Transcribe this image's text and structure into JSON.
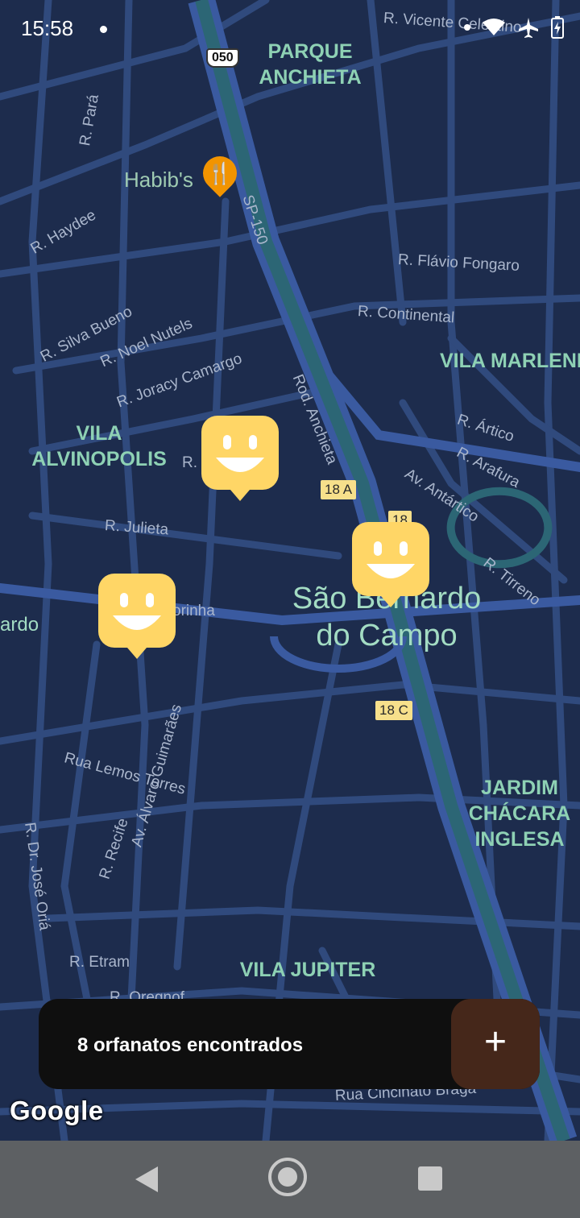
{
  "status_bar": {
    "time": "15:58"
  },
  "map": {
    "street_labels": [
      "R. Vicente Celestino",
      "R. Pará",
      "R. Haydee",
      "R. Flávio Fongaro",
      "R. Continental",
      "R. Silva Bueno",
      "R. Noel Nutels",
      "R. Joracy Camargo",
      "R. Ártico",
      "R. Arafura",
      "Av. Antártico",
      "R. Tirreno",
      "R. Julieta",
      "Rod. Anchieta",
      "SP-150",
      "Rua Lemos Torres",
      "R. Dr. José Oriá",
      "R. Recife",
      "Av. Álvaro Guimarães",
      "R. Etram",
      "Rua Cincinato Braga",
      "R. S",
      "R. Oregnof",
      "orinha",
      "ardo"
    ],
    "area_labels": [
      "PARQUE\nANCHIETA",
      "VILA MARLENE",
      "VILA\nALVINOPOLIS",
      "JARDIM\nCHÁCARA\nINGLESA",
      "VILA JUPITER"
    ],
    "city_label": "São Bernardo\ndo Campo",
    "road_shields": [
      "050",
      "18 A",
      "18 C",
      "18"
    ],
    "poi": {
      "name": "Habib's",
      "icon": "restaurant-icon",
      "color": "#f29400"
    },
    "marker_color": "#ffd666",
    "marker_icon": "smiley-icon"
  },
  "footer": {
    "count_text": "8 orfanatos encontrados",
    "add_label": "+",
    "add_color": "#45271a"
  },
  "attribution": "Google"
}
